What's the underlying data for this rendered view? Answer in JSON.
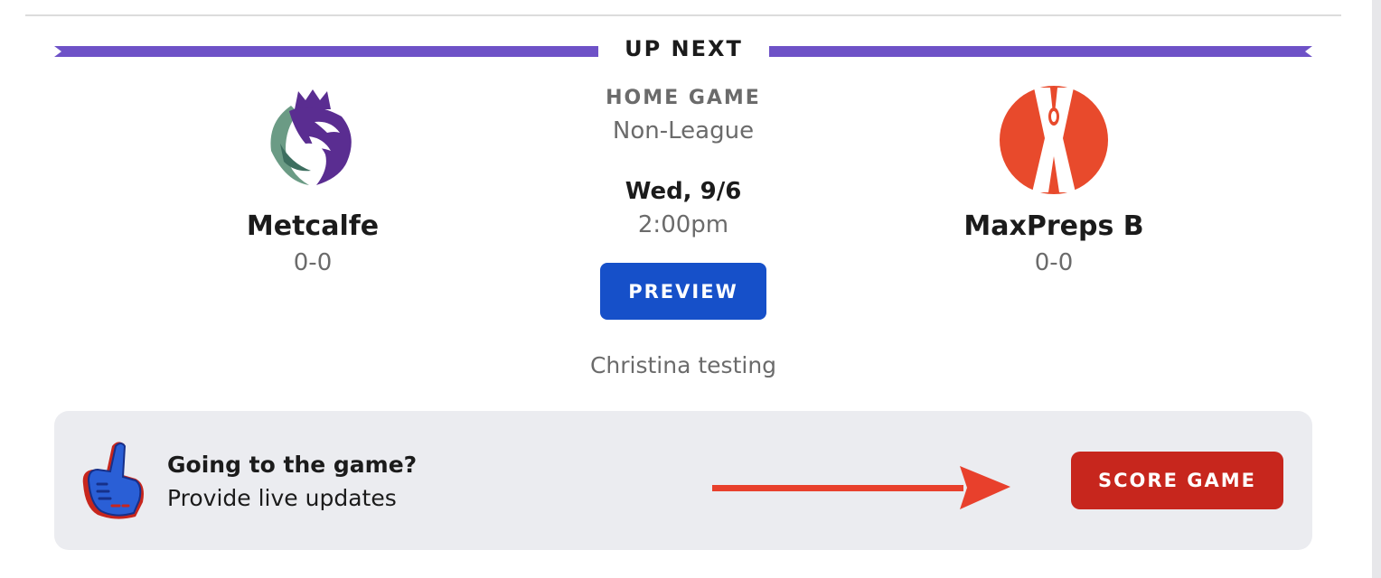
{
  "banner": {
    "title": "UP NEXT"
  },
  "home_team": {
    "name": "Metcalfe",
    "record": "0-0",
    "logo": "kings-lion-crest-icon"
  },
  "away_team": {
    "name": "MaxPreps B",
    "record": "0-0",
    "logo": "maxpreps-x-icon"
  },
  "game": {
    "type": "HOME GAME",
    "league": "Non-League",
    "date": "Wed, 9/6",
    "time": "2:00pm",
    "preview_label": "PREVIEW",
    "note": "Christina testing"
  },
  "live_panel": {
    "title": "Going to the game?",
    "subtitle": "Provide live updates",
    "icon": "foam-finger-icon",
    "annotation": "red-arrow-icon",
    "button_label": "SCORE GAME"
  },
  "colors": {
    "banner": "#6e52c7",
    "preview_button": "#1650c9",
    "score_button": "#c7261d",
    "maxpreps_logo": "#e84a2c",
    "panel_bg": "#ebecf0"
  }
}
